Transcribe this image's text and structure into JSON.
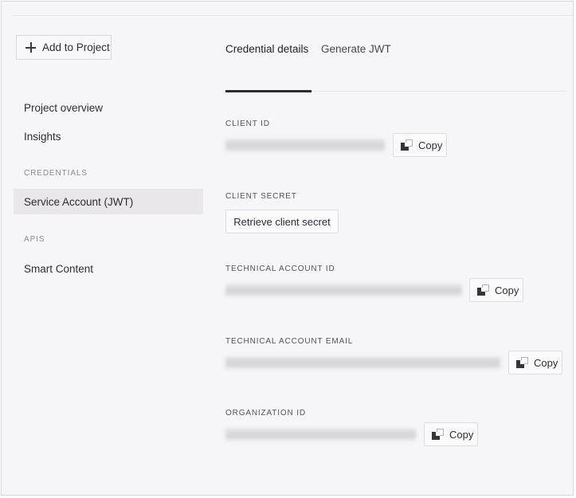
{
  "sidebar": {
    "add_button": {
      "label": "Add to Project",
      "icon": "plus-icon"
    },
    "items": [
      {
        "label": "Project overview",
        "selected": false
      },
      {
        "label": "Insights",
        "selected": false
      }
    ],
    "sections": [
      {
        "label": "CREDENTIALS",
        "items": [
          {
            "label": "Service Account (JWT)",
            "selected": true
          }
        ]
      },
      {
        "label": "APIS",
        "items": [
          {
            "label": "Smart Content",
            "selected": false
          }
        ]
      }
    ]
  },
  "main": {
    "tabs": [
      {
        "label": "Credential details",
        "active": true
      },
      {
        "label": "Generate JWT",
        "active": false
      }
    ],
    "fields": [
      {
        "label": "CLIENT ID",
        "type": "redacted-value",
        "value": "",
        "value_redacted": true,
        "action": {
          "label": "Copy",
          "icon": "copy-icon"
        }
      },
      {
        "label": "CLIENT SECRET",
        "type": "button",
        "action": {
          "label": "Retrieve client secret"
        }
      },
      {
        "label": "TECHNICAL ACCOUNT ID",
        "type": "redacted-value",
        "value": "",
        "value_redacted": true,
        "action": {
          "label": "Copy",
          "icon": "copy-icon"
        }
      },
      {
        "label": "TECHNICAL ACCOUNT EMAIL",
        "type": "redacted-value",
        "value": "",
        "value_redacted": true,
        "action": {
          "label": "Copy",
          "icon": "copy-icon"
        }
      },
      {
        "label": "ORGANIZATION ID",
        "type": "redacted-value",
        "value": "",
        "value_redacted": true,
        "action": {
          "label": "Copy",
          "icon": "copy-icon"
        }
      }
    ]
  },
  "colors": {
    "background": "#f6f5f7",
    "text_primary": "#2e2c33",
    "text_muted": "#8d8a92",
    "selected_row": "#e9e7eb",
    "active_tab_underline": "#2c2a30",
    "border": "#dedce1"
  }
}
